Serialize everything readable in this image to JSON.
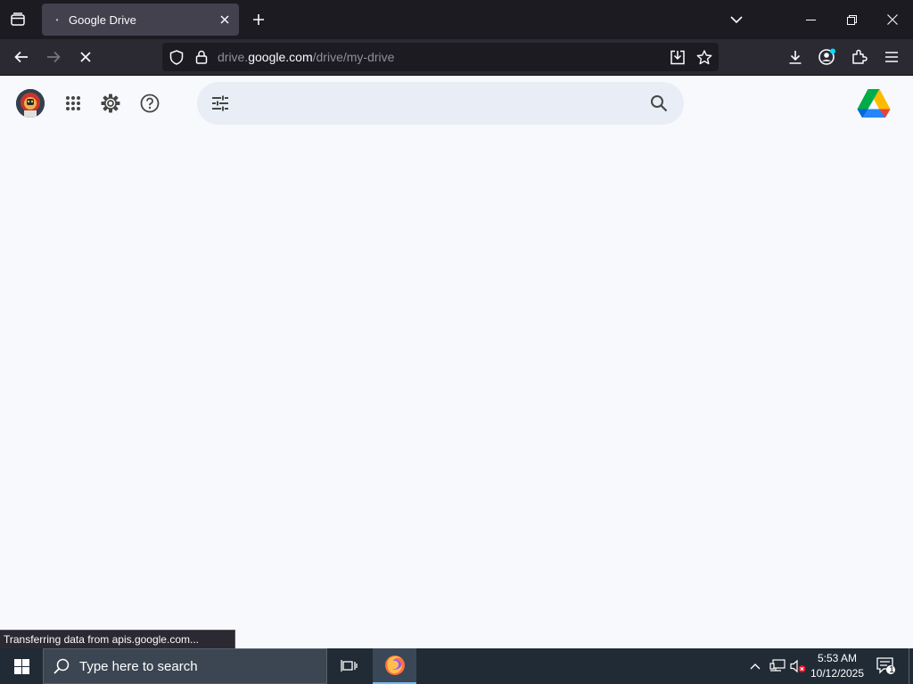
{
  "browser": {
    "tab": {
      "title": "Google Drive"
    },
    "url": {
      "host_prefix": "drive.",
      "host": "google.com",
      "path": "/drive/my-drive"
    },
    "status_text": "Transferring data from apis.google.com..."
  },
  "drive": {
    "search": {
      "value": "",
      "placeholder": ""
    }
  },
  "taskbar": {
    "search_placeholder": "Type here to search",
    "time": "5:53 AM",
    "date": "10/12/2025",
    "notification_count": "1"
  },
  "colors": {
    "tabbar_bg": "#1c1b22",
    "toolbar_bg": "#2b2a33",
    "page_bg": "#f8f9fc",
    "searchbox_bg": "#e9eef6",
    "taskbar_bg": "#202b36"
  },
  "icons": [
    "list-all-tabs-icon",
    "close-tab-icon",
    "new-tab-icon",
    "tab-overflow-chevron-icon",
    "minimize-icon",
    "restore-icon",
    "close-window-icon",
    "back-arrow-icon",
    "forward-arrow-icon",
    "stop-loading-icon",
    "shield-icon",
    "lock-icon",
    "save-page-icon",
    "bookmark-star-icon",
    "downloads-icon",
    "account-icon",
    "extensions-icon",
    "menu-icon",
    "apps-grid-icon",
    "settings-gear-icon",
    "help-icon",
    "search-options-icon",
    "search-icon",
    "google-drive-logo",
    "windows-start-icon",
    "task-view-icon",
    "firefox-icon",
    "tray-chevron-icon",
    "network-icon",
    "volume-muted-icon",
    "notifications-icon"
  ]
}
